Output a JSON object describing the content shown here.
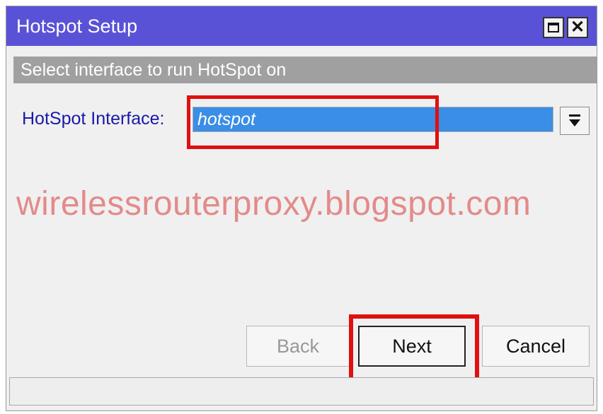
{
  "window": {
    "title": "Hotspot Setup",
    "maximize_icon": "maximize-icon",
    "close_icon": "close-icon",
    "close_glyph": "✕"
  },
  "step": {
    "instruction": "Select interface to run HotSpot on"
  },
  "form": {
    "interface_label": "HotSpot Interface:",
    "interface_value": "hotspot",
    "dropdown_icon": "dropdown-arrow-icon"
  },
  "watermark": "wirelessrouterproxy.blogspot.com",
  "buttons": {
    "back": "Back",
    "next": "Next",
    "cancel": "Cancel"
  },
  "colors": {
    "titlebar": "#5a52d6",
    "highlight": "#e01010",
    "selection": "#3a8ee6",
    "label": "#1a1aa8",
    "watermark": "#e38a8a"
  }
}
